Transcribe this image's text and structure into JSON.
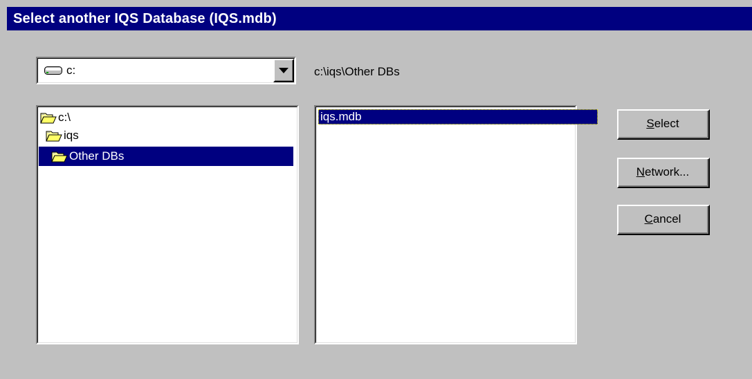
{
  "window": {
    "title": "Select another IQS Database (IQS.mdb)"
  },
  "drive_combo": {
    "value": "c:"
  },
  "current_path": "c:\\iqs\\Other DBs",
  "folders": [
    {
      "label": "c:\\",
      "level": 0,
      "selected": false
    },
    {
      "label": "iqs",
      "level": 1,
      "selected": false
    },
    {
      "label": "Other DBs",
      "level": 2,
      "selected": true
    }
  ],
  "files": [
    {
      "label": "iqs.mdb",
      "selected": true
    }
  ],
  "buttons": {
    "select": {
      "mnemonic": "S",
      "rest": "elect"
    },
    "network": {
      "mnemonic": "N",
      "rest": "etwork..."
    },
    "cancel": {
      "mnemonic": "C",
      "rest": "ancel"
    }
  },
  "colors": {
    "face": "#c0c0c0",
    "titlebar": "#000080",
    "selection": "#000080",
    "folder": "#ffff99"
  },
  "icons": {
    "drive": "hard-drive-icon",
    "folder_open": "open-folder-icon"
  }
}
